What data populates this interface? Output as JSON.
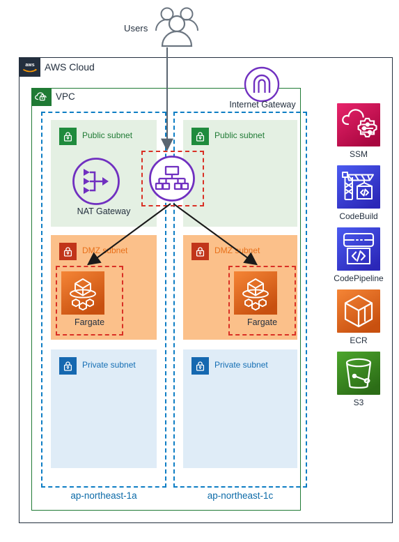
{
  "diagram": {
    "title": "AWS Cloud",
    "users": {
      "label": "Users",
      "icon": "users-icon"
    }
  },
  "cloud": {
    "label": "AWS Cloud",
    "badge_icon": "aws-logo-icon"
  },
  "vpc": {
    "label": "VPC",
    "badge_icon": "vpc-cloud-lock-icon",
    "border_color": "#1f7a34"
  },
  "internet_gateway": {
    "label": "Internet Gateway",
    "icon": "internet-gateway-icon",
    "color": "#7030c0"
  },
  "availability_zones": [
    {
      "id": "az-a",
      "label": "ap-northeast-1a",
      "color": "#0d6ba8"
    },
    {
      "id": "az-c",
      "label": "ap-northeast-1c",
      "color": "#0d6ba8"
    }
  ],
  "subnets": {
    "public": {
      "label": "Public subnet",
      "badge_icon": "lock-icon",
      "fill": "#e4f0e3",
      "accent": "#1f8b3d"
    },
    "dmz": {
      "label": "DMZ subnet",
      "badge_icon": "lock-icon",
      "fill": "#fbc08a",
      "accent": "#c1351a"
    },
    "private": {
      "label": "Private subnet",
      "badge_icon": "lock-icon",
      "fill": "#dfecf7",
      "accent": "#1568b0"
    }
  },
  "nat_gateway": {
    "label": "NAT Gateway",
    "icon": "nat-gateway-icon",
    "color": "#7030c0"
  },
  "load_balancer": {
    "icon": "elastic-load-balancer-icon",
    "color": "#7030c0",
    "highlight_color": "#d93025"
  },
  "fargate": [
    {
      "label": "Fargate",
      "icon": "fargate-icon"
    },
    {
      "label": "Fargate",
      "icon": "fargate-icon"
    }
  ],
  "services": [
    {
      "name": "SSM",
      "icon": "ssm-icon",
      "color": "#c9165b"
    },
    {
      "name": "CodeBuild",
      "icon": "codebuild-icon",
      "color": "#3b48cc"
    },
    {
      "name": "CodePipeline",
      "icon": "codepipeline-icon",
      "color": "#3b48cc"
    },
    {
      "name": "ECR",
      "icon": "ecr-icon",
      "color": "#e8701a"
    },
    {
      "name": "S3",
      "icon": "s3-icon",
      "color": "#3f8624"
    }
  ]
}
